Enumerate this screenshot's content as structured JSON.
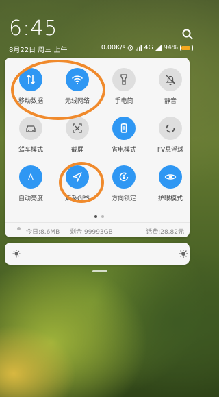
{
  "status_bar": {
    "time": "6:45",
    "date": "8月22日 周三 上午",
    "network_speed": "0.00K/s",
    "network_type": "4G",
    "battery": "94%",
    "battery_color": "#f3a81f"
  },
  "toggles": [
    {
      "label": "移动数据",
      "state": "on",
      "icon": "mobile-data-icon"
    },
    {
      "label": "无线网络",
      "state": "on",
      "icon": "wifi-icon"
    },
    {
      "label": "手电筒",
      "state": "off",
      "icon": "flashlight-icon"
    },
    {
      "label": "静音",
      "state": "off",
      "icon": "mute-bell-icon"
    },
    {
      "label": "驾车模式",
      "state": "off",
      "icon": "car-icon"
    },
    {
      "label": "截屏",
      "state": "off",
      "icon": "screenshot-icon"
    },
    {
      "label": "省电模式",
      "state": "on",
      "icon": "battery-saver-icon"
    },
    {
      "label": "FV悬浮球",
      "state": "off",
      "icon": "floating-ball-icon"
    },
    {
      "label": "自动亮度",
      "state": "on",
      "icon": "auto-brightness-icon"
    },
    {
      "label": "双系GPS",
      "state": "on",
      "icon": "gps-icon"
    },
    {
      "label": "方向锁定",
      "state": "on",
      "icon": "rotation-lock-icon"
    },
    {
      "label": "护眼模式",
      "state": "on",
      "icon": "eye-icon"
    }
  ],
  "data_usage": {
    "today": "今日:8.6MB",
    "remaining": "剩余:99993GB",
    "balance": "话费:28.82元"
  },
  "brightness": {
    "icon_low": "sun-small-icon",
    "icon_high": "sun-large-icon"
  },
  "colors": {
    "accent": "#2f97f3",
    "annotation": "#f08a2c"
  }
}
